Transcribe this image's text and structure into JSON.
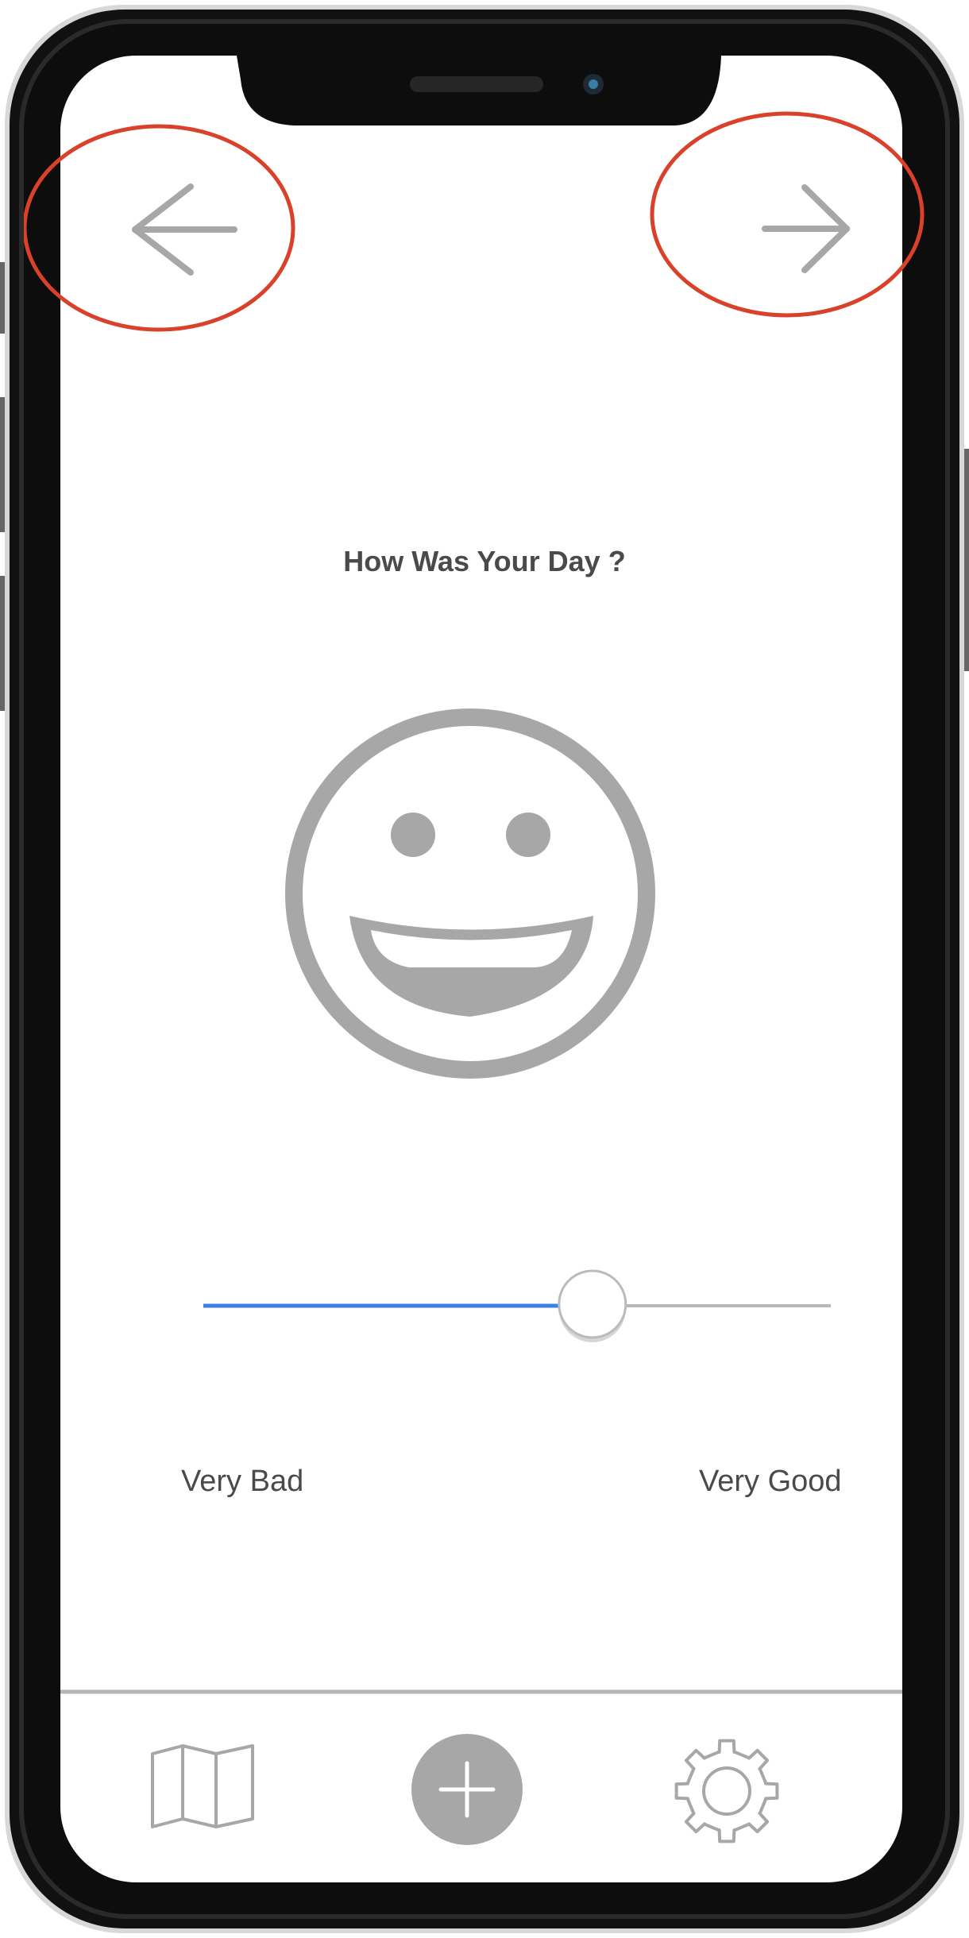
{
  "question": "How Was Your Day ?",
  "mood_slider": {
    "value": 0.62,
    "min_label": "Very Bad",
    "max_label": "Very Good"
  },
  "nav": {
    "back_icon": "arrow-left-icon",
    "forward_icon": "arrow-right-icon"
  },
  "mood_icon": "grinning-face-icon",
  "tab_bar": {
    "items": [
      {
        "icon": "map-icon"
      },
      {
        "icon": "plus-icon"
      },
      {
        "icon": "gear-icon"
      }
    ]
  },
  "colors": {
    "accent": "#3b82e6",
    "icon_gray": "#a7a7a7",
    "highlight": "#d9412b",
    "device_frame": "#111111"
  }
}
